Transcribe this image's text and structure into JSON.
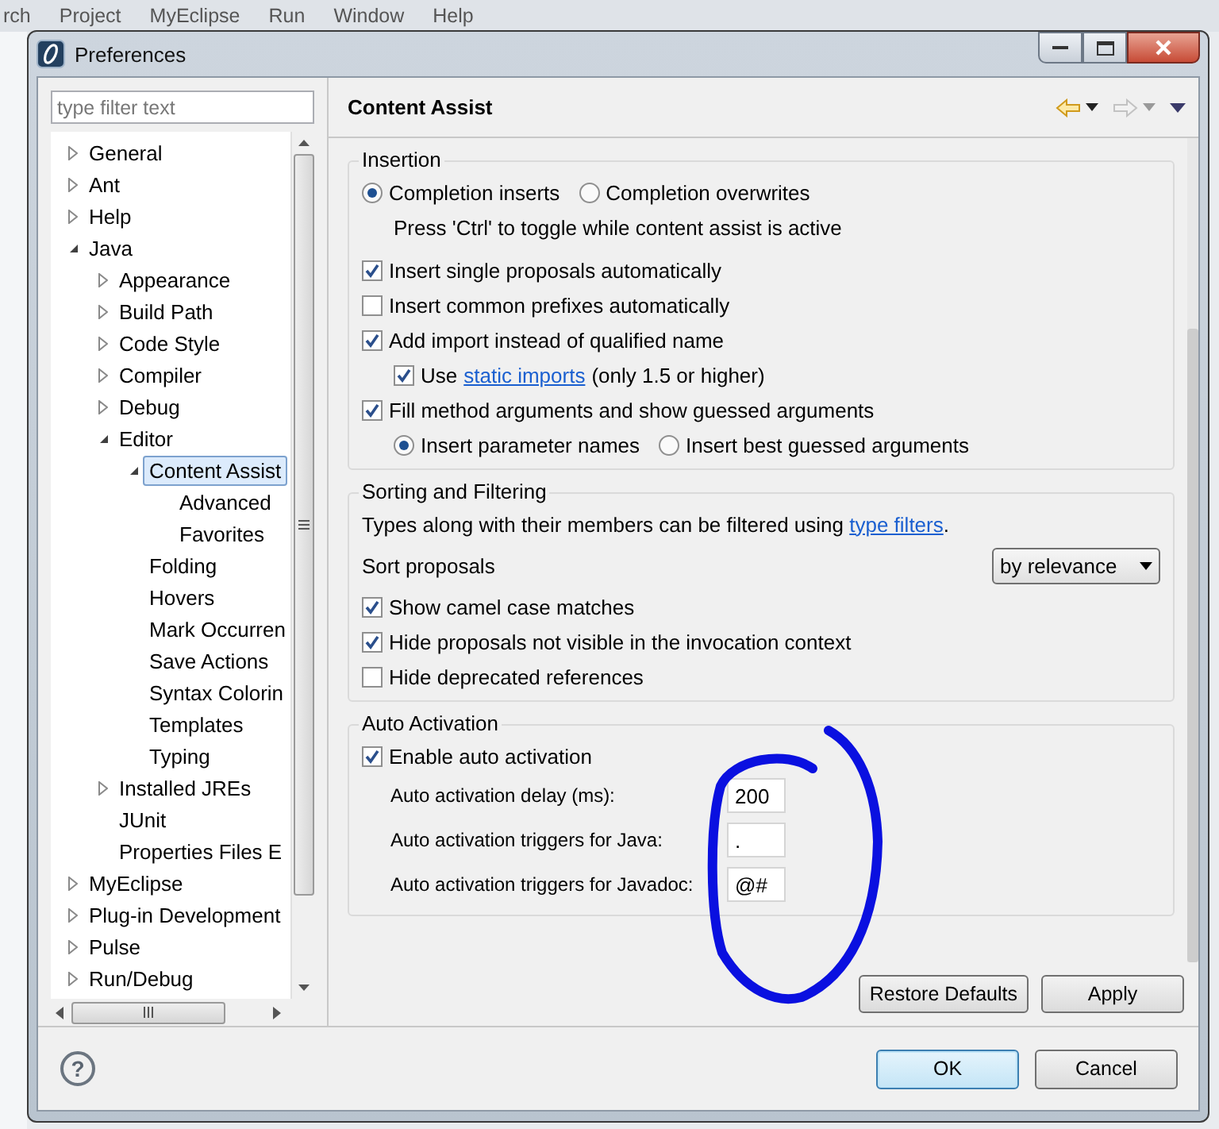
{
  "menubar": [
    "rch",
    "Project",
    "MyEclipse",
    "Run",
    "Window",
    "Help"
  ],
  "window": {
    "title": "Preferences"
  },
  "filter": {
    "placeholder": "type filter text"
  },
  "tree": [
    {
      "label": "General",
      "expanded": false,
      "selected": false
    },
    {
      "label": "Ant",
      "expanded": false,
      "selected": false
    },
    {
      "label": "Help",
      "expanded": false,
      "selected": false
    },
    {
      "label": "Java",
      "expanded": true,
      "selected": false,
      "children": [
        {
          "label": "Appearance",
          "expanded": false,
          "selected": false
        },
        {
          "label": "Build Path",
          "expanded": false,
          "selected": false
        },
        {
          "label": "Code Style",
          "expanded": false,
          "selected": false
        },
        {
          "label": "Compiler",
          "expanded": false,
          "selected": false
        },
        {
          "label": "Debug",
          "expanded": false,
          "selected": false
        },
        {
          "label": "Editor",
          "expanded": true,
          "selected": false,
          "children": [
            {
              "label": "Content Assist",
              "expanded": true,
              "selected": true,
              "children": [
                {
                  "label": "Advanced",
                  "selected": false
                },
                {
                  "label": "Favorites",
                  "selected": false
                }
              ]
            },
            {
              "label": "Folding",
              "selected": false
            },
            {
              "label": "Hovers",
              "selected": false
            },
            {
              "label": "Mark Occurren",
              "selected": false
            },
            {
              "label": "Save Actions",
              "selected": false
            },
            {
              "label": "Syntax Colorin",
              "selected": false
            },
            {
              "label": "Templates",
              "selected": false
            },
            {
              "label": "Typing",
              "selected": false
            }
          ]
        },
        {
          "label": "Installed JREs",
          "expanded": false,
          "selected": false
        },
        {
          "label": "JUnit",
          "selected": false
        },
        {
          "label": "Properties Files E",
          "selected": false
        }
      ]
    },
    {
      "label": "MyEclipse",
      "expanded": false,
      "selected": false
    },
    {
      "label": "Plug-in Development",
      "expanded": false,
      "selected": false
    },
    {
      "label": "Pulse",
      "expanded": false,
      "selected": false
    },
    {
      "label": "Run/Debug",
      "expanded": false,
      "selected": false
    }
  ],
  "page": {
    "title": "Content Assist"
  },
  "groups": [
    {
      "title": "Insertion",
      "rows": [
        {
          "kind": "radios",
          "options": [
            {
              "label": "Completion inserts",
              "selected": true
            },
            {
              "label": "Completion overwrites",
              "selected": false
            }
          ]
        },
        {
          "kind": "note",
          "text": "Press 'Ctrl' to toggle while content assist is active"
        },
        {
          "kind": "checkbox",
          "label": "Insert single proposals automatically",
          "checked": true
        },
        {
          "kind": "checkbox",
          "label": "Insert common prefixes automatically",
          "checked": false
        },
        {
          "kind": "checkbox",
          "label": "Add import instead of qualified name",
          "checked": true,
          "children": [
            {
              "kind": "checkbox",
              "label": "Use",
              "link": "static imports",
              "suffix": "(only 1.5 or higher)",
              "checked": true
            }
          ]
        },
        {
          "kind": "checkbox",
          "label": "Fill method arguments and show guessed arguments",
          "checked": true,
          "children": [
            {
              "kind": "radios",
              "options": [
                {
                  "label": "Insert parameter names",
                  "selected": true
                },
                {
                  "label": "Insert best guessed arguments",
                  "selected": false
                }
              ]
            }
          ]
        }
      ]
    },
    {
      "title": "Sorting and Filtering",
      "rows": [
        {
          "kind": "note",
          "text": "Types along with their members can be filtered using",
          "link": "type filters",
          "suffix": "."
        },
        {
          "kind": "select",
          "label": "Sort proposals",
          "value": "by relevance"
        },
        {
          "kind": "checkbox",
          "label": "Show camel case matches",
          "checked": true
        },
        {
          "kind": "checkbox",
          "label": "Hide proposals not visible in the invocation context",
          "checked": true
        },
        {
          "kind": "checkbox",
          "label": "Hide deprecated references",
          "checked": false
        }
      ]
    },
    {
      "title": "Auto Activation",
      "rows": [
        {
          "kind": "checkbox",
          "label": "Enable auto activation",
          "checked": true,
          "children": [
            {
              "kind": "field",
              "label": "Auto activation delay (ms):",
              "value": "200"
            },
            {
              "kind": "field",
              "label": "Auto activation triggers for Java:",
              "value": "."
            },
            {
              "kind": "field",
              "label": "Auto activation triggers for Javadoc:",
              "value": "@#"
            }
          ]
        }
      ]
    }
  ],
  "page_buttons": [
    "Restore Defaults",
    "Apply"
  ],
  "help": "?",
  "dialog_buttons": [
    {
      "label": "OK",
      "focused": true
    },
    {
      "label": "Cancel",
      "focused": false
    }
  ]
}
